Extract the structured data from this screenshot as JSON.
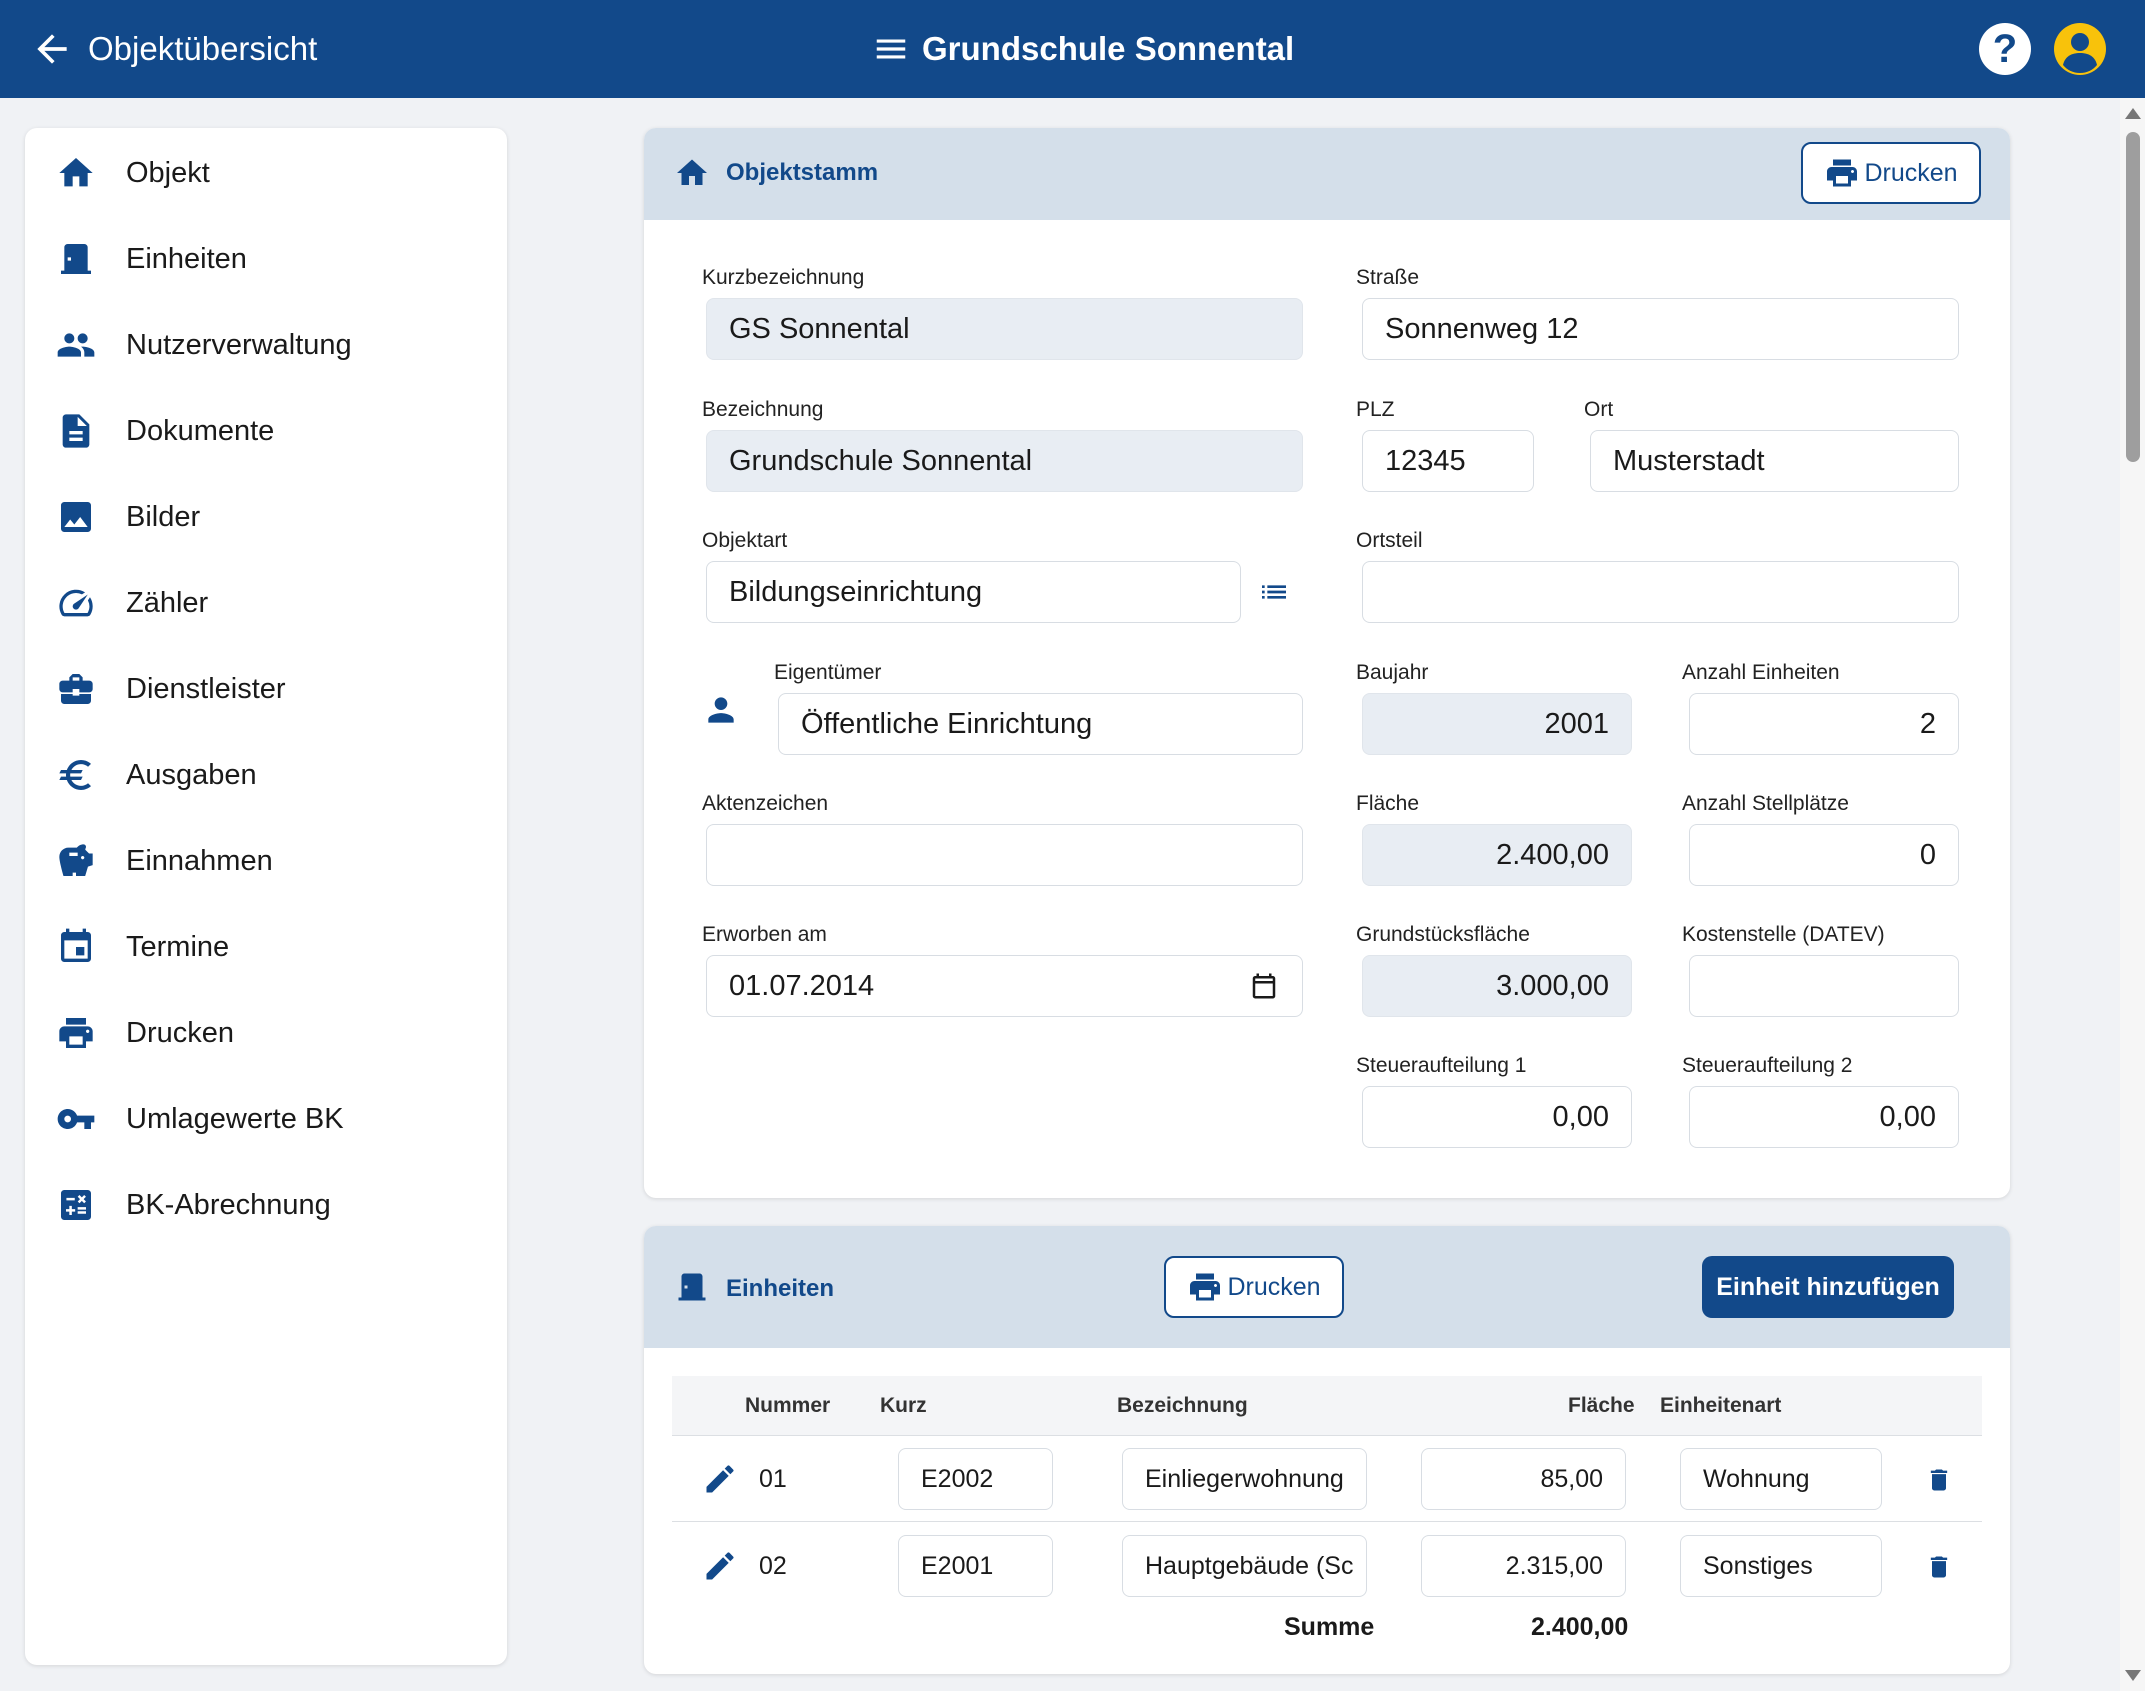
{
  "header": {
    "back_label": "Objektübersicht",
    "title": "Grundschule Sonnental",
    "help_label": "?",
    "accent_color": "#12498a",
    "avatar_color": "#f8c20b"
  },
  "sidebar": {
    "items": [
      {
        "label": "Objekt",
        "icon": "home-icon"
      },
      {
        "label": "Einheiten",
        "icon": "door-icon"
      },
      {
        "label": "Nutzerverwaltung",
        "icon": "people-icon"
      },
      {
        "label": "Dokumente",
        "icon": "document-icon"
      },
      {
        "label": "Bilder",
        "icon": "image-icon"
      },
      {
        "label": "Zähler",
        "icon": "gauge-icon"
      },
      {
        "label": "Dienstleister",
        "icon": "toolbox-icon"
      },
      {
        "label": "Ausgaben",
        "icon": "euro-icon"
      },
      {
        "label": "Einnahmen",
        "icon": "piggy-bank-icon"
      },
      {
        "label": "Termine",
        "icon": "calendar-icon"
      },
      {
        "label": "Drucken",
        "icon": "printer-icon"
      },
      {
        "label": "Umlagewerte BK",
        "icon": "key-icon"
      },
      {
        "label": "BK-Abrechnung",
        "icon": "calculator-icon"
      }
    ]
  },
  "objektstamm": {
    "title": "Objektstamm",
    "print_label": "Drucken",
    "fields": {
      "kurzbezeichnung": {
        "label": "Kurzbezeichnung",
        "value": "GS Sonnental"
      },
      "strasse": {
        "label": "Straße",
        "value": "Sonnenweg 12"
      },
      "bezeichnung": {
        "label": "Bezeichnung",
        "value": "Grundschule Sonnental"
      },
      "plz": {
        "label": "PLZ",
        "value": "12345"
      },
      "ort": {
        "label": "Ort",
        "value": "Musterstadt"
      },
      "objektart": {
        "label": "Objektart",
        "value": "Bildungseinrichtung"
      },
      "ortsteil": {
        "label": "Ortsteil",
        "value": ""
      },
      "eigentuemer": {
        "label": "Eigentümer",
        "value": "Öffentliche Einrichtung"
      },
      "baujahr": {
        "label": "Baujahr",
        "value": "2001"
      },
      "anzahl_einheiten": {
        "label": "Anzahl Einheiten",
        "value": "2"
      },
      "aktenzeichen": {
        "label": "Aktenzeichen",
        "value": ""
      },
      "flaeche": {
        "label": "Fläche",
        "value": "2.400,00"
      },
      "anzahl_stellplaetze": {
        "label": "Anzahl Stellplätze",
        "value": "0"
      },
      "erworben_am": {
        "label": "Erworben am",
        "value": "01.07.2014"
      },
      "grundstuecksflaeche": {
        "label": "Grundstücksfläche",
        "value": "3.000,00"
      },
      "kostenstelle": {
        "label": "Kostenstelle (DATEV)",
        "value": ""
      },
      "steueraufteilung1": {
        "label": "Steueraufteilung 1",
        "value": "0,00"
      },
      "steueraufteilung2": {
        "label": "Steueraufteilung 2",
        "value": "0,00"
      }
    }
  },
  "einheiten": {
    "title": "Einheiten",
    "print_label": "Drucken",
    "add_label": "Einheit hinzufügen",
    "columns": {
      "nummer": "Nummer",
      "kurz": "Kurz",
      "bezeichnung": "Bezeichnung",
      "flaeche": "Fläche",
      "einheitenart": "Einheitenart"
    },
    "rows": [
      {
        "nummer": "01",
        "kurz": "E2002",
        "bezeichnung": "Einliegerwohnung",
        "flaeche": "85,00",
        "einheitenart": "Wohnung"
      },
      {
        "nummer": "02",
        "kurz": "E2001",
        "bezeichnung": "Hauptgebäude (Sc",
        "flaeche": "2.315,00",
        "einheitenart": "Sonstiges"
      }
    ],
    "sum_label": "Summe",
    "sum_value": "2.400,00"
  }
}
